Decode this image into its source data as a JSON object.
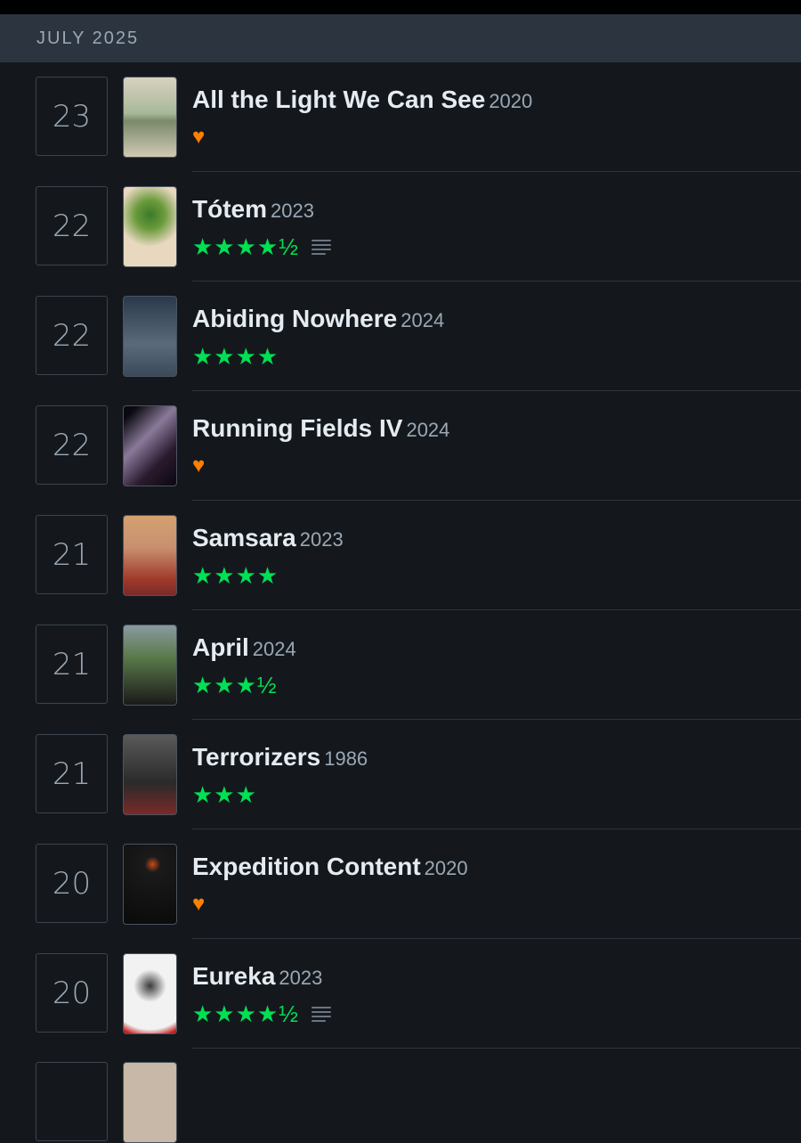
{
  "header": {
    "month": "JULY 2025"
  },
  "entries": [
    {
      "day": "23",
      "title": "All the Light We Can See",
      "year": "2020",
      "stars": "",
      "liked": true,
      "review": false
    },
    {
      "day": "22",
      "title": "Tótem",
      "year": "2023",
      "stars": "★★★★½",
      "liked": false,
      "review": true
    },
    {
      "day": "22",
      "title": "Abiding Nowhere",
      "year": "2024",
      "stars": "★★★★",
      "liked": false,
      "review": false
    },
    {
      "day": "22",
      "title": "Running Fields IV",
      "year": "2024",
      "stars": "",
      "liked": true,
      "review": false
    },
    {
      "day": "21",
      "title": "Samsara",
      "year": "2023",
      "stars": "★★★★",
      "liked": false,
      "review": false
    },
    {
      "day": "21",
      "title": "April",
      "year": "2024",
      "stars": "★★★½",
      "liked": false,
      "review": false
    },
    {
      "day": "21",
      "title": "Terrorizers",
      "year": "1986",
      "stars": "★★★",
      "liked": false,
      "review": false
    },
    {
      "day": "20",
      "title": "Expedition Content",
      "year": "2020",
      "stars": "",
      "liked": true,
      "review": false
    },
    {
      "day": "20",
      "title": "Eureka",
      "year": "2023",
      "stars": "★★★★½",
      "liked": false,
      "review": true
    }
  ],
  "heart_glyph": "♥",
  "colors": {
    "star": "#00e054",
    "heart": "#ff8000",
    "background": "#14181c",
    "header": "#2c3440"
  },
  "posters": [
    "#c8c0a8",
    "#e8d4b8",
    "#4a5a6a",
    "#3a2a3e",
    "#b85a3a",
    "#3a4a2a",
    "#3a3a3a",
    "#0a0a0a",
    "#f0f0f0"
  ]
}
